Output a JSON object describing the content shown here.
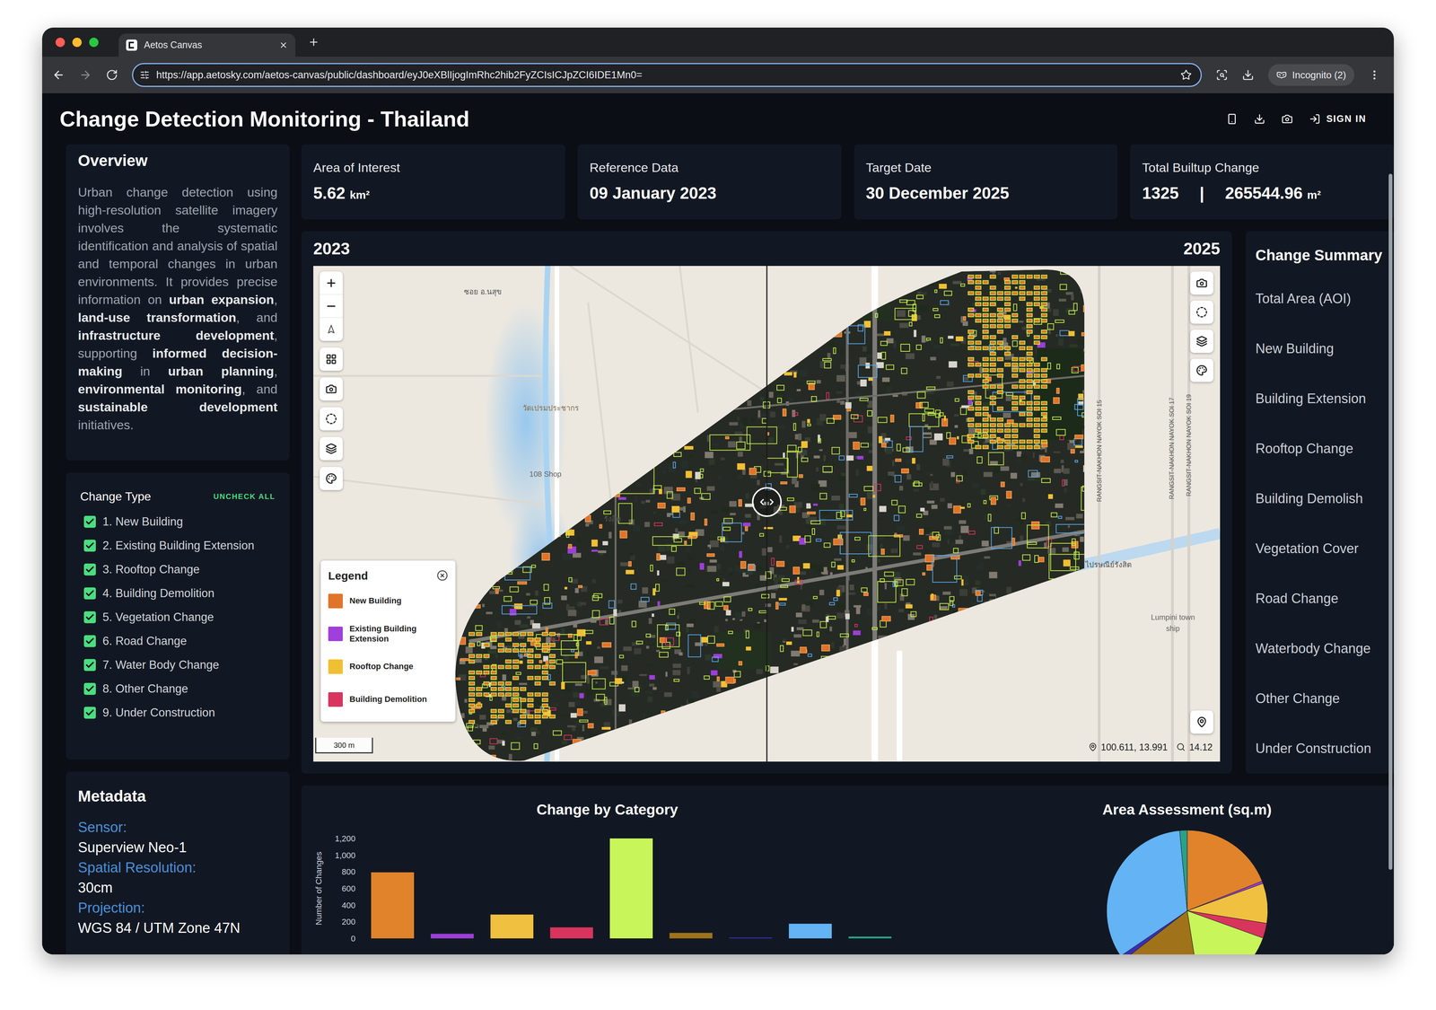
{
  "browser": {
    "tab_title": "Aetos Canvas",
    "url": "https://app.aetosky.com/aetos-canvas/public/dashboard/eyJ0eXBlIjogImRhc2hib2FyZCIsICJpZCI6IDE1Mn0=",
    "profile": "Incognito (2)"
  },
  "header": {
    "title": "Change Detection Monitoring - Thailand",
    "sign_in": "SIGN IN"
  },
  "overview": {
    "title": "Overview",
    "segments": [
      {
        "text": "Urban change detection using high-resolution satellite imagery involves the systematic identification and analysis of spatial and temporal changes in urban environments. It provides precise information on ",
        "bold": false
      },
      {
        "text": "urban expansion",
        "bold": true
      },
      {
        "text": ", ",
        "bold": false
      },
      {
        "text": "land-use transformation",
        "bold": true
      },
      {
        "text": ", and ",
        "bold": false
      },
      {
        "text": "infrastructure development",
        "bold": true
      },
      {
        "text": ", supporting ",
        "bold": false
      },
      {
        "text": "informed decision-making",
        "bold": true
      },
      {
        "text": " in ",
        "bold": false
      },
      {
        "text": "urban planning",
        "bold": true
      },
      {
        "text": ", ",
        "bold": false
      },
      {
        "text": "environmental monitoring",
        "bold": true
      },
      {
        "text": ", and ",
        "bold": false
      },
      {
        "text": "sustainable development",
        "bold": true
      },
      {
        "text": " initiatives.",
        "bold": false
      }
    ]
  },
  "change_types": {
    "title": "Change Type",
    "action": "UNCHECK ALL",
    "items": [
      {
        "label": "1. New Building",
        "checked": true
      },
      {
        "label": "2. Existing Building Extension",
        "checked": true
      },
      {
        "label": "3. Rooftop Change",
        "checked": true
      },
      {
        "label": "4. Building Demolition",
        "checked": true
      },
      {
        "label": "5. Vegetation Change",
        "checked": true
      },
      {
        "label": "6. Road Change",
        "checked": true
      },
      {
        "label": "7. Water Body Change",
        "checked": true
      },
      {
        "label": "8. Other Change",
        "checked": true
      },
      {
        "label": "9. Under Construction",
        "checked": true
      }
    ]
  },
  "metadata": {
    "title": "Metadata",
    "fields": [
      {
        "label": "Sensor:",
        "value": "Superview Neo-1"
      },
      {
        "label": "Spatial Resolution:",
        "value": "30cm"
      },
      {
        "label": "Projection:",
        "value": "WGS 84 / UTM Zone 47N"
      }
    ]
  },
  "stats": [
    {
      "label": "Area of Interest",
      "parts": [
        {
          "text": "5.62",
          "kind": "value"
        },
        {
          "text": "km²",
          "kind": "unit"
        }
      ]
    },
    {
      "label": "Reference Data",
      "parts": [
        {
          "text": "09 January 2023",
          "kind": "value"
        }
      ]
    },
    {
      "label": "Target Date",
      "parts": [
        {
          "text": "30 December 2025",
          "kind": "value"
        }
      ]
    },
    {
      "label": "Total Builtup Change",
      "parts": [
        {
          "text": "1325",
          "kind": "value"
        },
        {
          "text": "|",
          "kind": "sep"
        },
        {
          "text": "265544.96",
          "kind": "value"
        },
        {
          "text": "m²",
          "kind": "unit"
        }
      ]
    }
  ],
  "map": {
    "left_year": "2023",
    "right_year": "2025",
    "labels": [
      "ซอย อ.นสุข",
      "วัดเปรมประชากร",
      "108 Shop",
      "รังสิต",
      "ไปรษณีย์รังสิต",
      "Lumpini town ship",
      "RANGSIT-NAKHON NAYOK SOI 15",
      "RANGSIT-NAKHON NAYOK SOI 17",
      "RANGSIT-NAKHON NAYOK SOI 19"
    ],
    "scale": "300 m",
    "coords": "100.611, 13.991",
    "zoom": "14.12",
    "legend": {
      "title": "Legend",
      "items": [
        {
          "label": "New Building",
          "color": "#e0742a"
        },
        {
          "label": "Existing Building Extension",
          "color": "#a03fd9"
        },
        {
          "label": "Rooftop Change",
          "color": "#f0c033"
        },
        {
          "label": "Building Demolition",
          "color": "#d9345e"
        }
      ]
    }
  },
  "summary": {
    "title": "Change Summary",
    "items": [
      "Total Area (AOI)",
      "New Building",
      "Building Extension",
      "Rooftop Change",
      "Building Demolish",
      "Vegetation Cover",
      "Road Change",
      "Waterbody Change",
      "Other Change",
      "Under Construction"
    ]
  },
  "bar_chart": {
    "title": "Change by Category",
    "y_axis": "Number of Changes",
    "ticks": [
      "0",
      "200",
      "400",
      "600",
      "800",
      "1,000",
      "1,200"
    ],
    "values": [
      793,
      55,
      286,
      132,
      1200,
      66,
      11,
      176,
      22
    ],
    "colors": [
      "#e0832a",
      "#9b3fd6",
      "#f0c040",
      "#d9345e",
      "#c8f55a",
      "#a0721a",
      "#3b2fb0",
      "#63b3f5",
      "#2aa189"
    ]
  },
  "pie_chart": {
    "title": "Area Assessment (sq.m)",
    "values": [
      95000,
      2500,
      40000,
      15000,
      85000,
      85000,
      5000,
      165000,
      7500
    ],
    "colors": [
      "#e0832a",
      "#9b3fd6",
      "#f0c040",
      "#d9345e",
      "#c8f55a",
      "#a0721a",
      "#3b2fb0",
      "#63b3f5",
      "#2aa189"
    ]
  }
}
